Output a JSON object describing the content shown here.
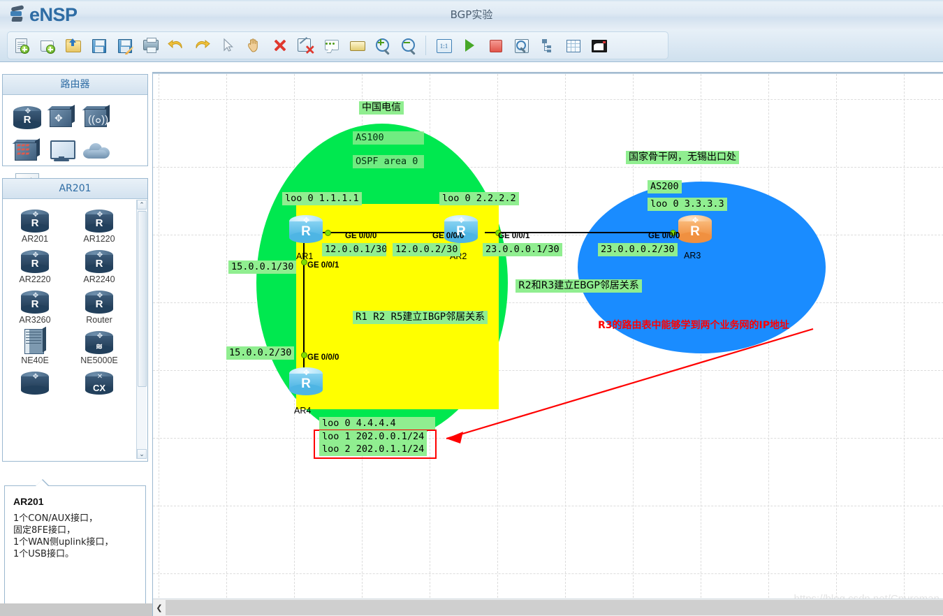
{
  "app": {
    "name": "eNSP",
    "window_title": "BGP实验"
  },
  "toolbar": {
    "buttons": [
      {
        "name": "new-topology",
        "icon": "new-document-icon",
        "label": "新建"
      },
      {
        "name": "new-device",
        "icon": "new-scroll-icon",
        "label": "新建设备"
      },
      {
        "name": "open",
        "icon": "open-folder-icon",
        "label": "打开"
      },
      {
        "name": "save",
        "icon": "save-floppy-icon",
        "label": "保存"
      },
      {
        "name": "save-as",
        "icon": "save-as-floppy-icon",
        "label": "另存为"
      },
      {
        "name": "print",
        "icon": "printer-icon",
        "label": "打印"
      },
      {
        "name": "undo",
        "icon": "undo-arrow-icon",
        "label": "撤销"
      },
      {
        "name": "redo",
        "icon": "redo-arrow-icon",
        "label": "恢复"
      },
      {
        "name": "select",
        "icon": "cursor-icon",
        "label": "选择"
      },
      {
        "name": "pan",
        "icon": "hand-icon",
        "label": "移动"
      },
      {
        "name": "delete",
        "icon": "delete-x-icon",
        "label": "删除"
      },
      {
        "name": "delete-link",
        "icon": "delete-link-icon",
        "label": "删除连线"
      },
      {
        "name": "add-note",
        "icon": "note-balloon-icon",
        "label": "添加描述"
      },
      {
        "name": "add-shape",
        "icon": "yellow-rect-icon",
        "label": "添加图形"
      },
      {
        "name": "zoom-in",
        "icon": "zoom-in-icon",
        "label": "放大"
      },
      {
        "name": "zoom-out",
        "icon": "zoom-out-icon",
        "label": "缩小"
      },
      {
        "name": "zoom-reset",
        "icon": "zoom-1to1-icon",
        "label": "1:1"
      },
      {
        "name": "start-all",
        "icon": "play-icon",
        "label": "开启设备"
      },
      {
        "name": "stop-all",
        "icon": "stop-icon",
        "label": "关闭设备"
      },
      {
        "name": "packet-capture",
        "icon": "capture-magnifier-icon",
        "label": "数据抓包"
      },
      {
        "name": "topology-tree",
        "icon": "tree-icon",
        "label": "拓扑树"
      },
      {
        "name": "grid-toggle",
        "icon": "grid-icon",
        "label": "网格"
      },
      {
        "name": "minimize-window",
        "icon": "window-restore-icon",
        "label": "窗口"
      }
    ],
    "zoom_label": "1:1"
  },
  "sidebar": {
    "section1_title": "路由器",
    "section1_icons": [
      {
        "name": "router-icon",
        "glyph": "R"
      },
      {
        "name": "switch-icon",
        "glyph": "switch"
      },
      {
        "name": "wireless-ap-icon",
        "glyph": "wifi"
      },
      {
        "name": "firewall-icon",
        "glyph": "fw"
      },
      {
        "name": "endpoint-pc-icon",
        "glyph": "pc"
      },
      {
        "name": "cloud-icon",
        "glyph": "cloud"
      },
      {
        "name": "connection-icon",
        "glyph": "bolt"
      }
    ],
    "section2_title": "AR201",
    "devices": [
      {
        "name": "AR201"
      },
      {
        "name": "AR1220"
      },
      {
        "name": "AR2220"
      },
      {
        "name": "AR2240"
      },
      {
        "name": "AR3260"
      },
      {
        "name": "Router"
      },
      {
        "name": "NE40E"
      },
      {
        "name": "NE5000E"
      },
      {
        "name": ""
      },
      {
        "name": "CX"
      }
    ],
    "scroll_up": "⌃",
    "scroll_down": "⌄",
    "info": {
      "title": "AR201",
      "lines": [
        "1个CON/AUX接口，",
        "固定8FE接口，",
        "1个WAN侧uplink接口，",
        "1个USB接口。"
      ]
    }
  },
  "canvas": {
    "watermark": "https://blog.csdn.net/Cpureman",
    "scroll_left_arrow": "❮",
    "zones": [
      {
        "name": "china-telecom-cloud",
        "label": "中国电信",
        "color": "#00e84f"
      },
      {
        "name": "national-backbone-cloud",
        "label": "国家骨干网，无锡出口处",
        "color": "#1a8cff"
      },
      {
        "name": "ibgp-region",
        "color": "#ffff00"
      }
    ],
    "labels": {
      "telecom": "中国电信",
      "backbone": "国家骨干网，无锡出口处",
      "as100": "AS100",
      "ospf_area": "OSPF area 0",
      "as200": "AS200",
      "loo_r1": "loo 0 1.1.1.1",
      "loo_r2": "loo 0 2.2.2.2",
      "loo_r3": "loo 0 3.3.3.3",
      "loo_r4_0": "loo 0 4.4.4.4",
      "loo_r4_1": "loo 1 202.0.0.1/24",
      "loo_r4_2": "loo 2 202.0.1.1/24",
      "ip_12_1": "12.0.0.1/30",
      "ip_12_2": "12.0.0.2/30",
      "ip_23_1": "23.0.0.0.1/30",
      "ip_23_2": "23.0.0.0.2/30",
      "ip_15_1": "15.0.0.1/30",
      "ip_15_2": "15.0.0.2/30",
      "ebgp_note": "R2和R3建立EBGP邻居关系",
      "ibgp_note": "R1 R2 R5建立IBGP邻居关系"
    },
    "interfaces": {
      "r1_ge000": "GE 0/0/0",
      "r2_ge000": "GE 0/0/0",
      "r2_ge001": "GE 0/0/1",
      "r3_ge000": "GE 0/0/0",
      "r1_ge001": "GE 0/0/1",
      "r4_ge000": "GE 0/0/0"
    },
    "devices": [
      {
        "name": "AR1",
        "label": "AR1",
        "glyph": "R",
        "color": "blue"
      },
      {
        "name": "AR2",
        "label": "AR2",
        "glyph": "R",
        "color": "blue"
      },
      {
        "name": "AR3",
        "label": "AR3",
        "glyph": "R",
        "color": "orange"
      },
      {
        "name": "AR4",
        "label": "AR4",
        "glyph": "R",
        "color": "blue"
      }
    ],
    "annotation": {
      "text": "R3的路由表中能够学到两个业务网的IP地址",
      "color": "#ff0000"
    }
  }
}
